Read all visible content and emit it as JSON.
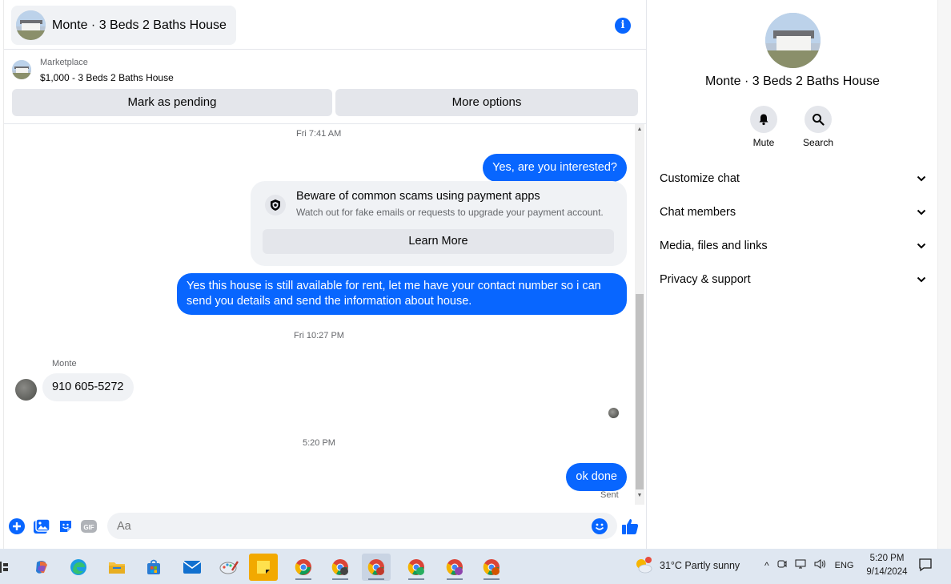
{
  "chat_header": {
    "title": "Monte · 3 Beds 2 Baths House"
  },
  "listing": {
    "source": "Marketplace",
    "price_title": "$1,000 - 3 Beds 2 Baths House",
    "mark_pending_label": "Mark as pending",
    "more_options_label": "More options"
  },
  "messages": {
    "ts1": "Fri 7:41 AM",
    "msg1": "Yes, are you interested?",
    "scam_title": "Beware of common scams using payment apps",
    "scam_desc": "Watch out for fake emails or requests to upgrade your payment account.",
    "learn_more": "Learn More",
    "msg2": "Yes this house is still available for rent, let me have your contact number so i can send you details and send the information about house.",
    "ts2": "Fri 10:27 PM",
    "sender_name": "Monte",
    "msg3": "910 605-5272",
    "ts3": "5:20 PM",
    "msg4": "ok done",
    "status": "Sent"
  },
  "composer": {
    "placeholder": "Aa",
    "gif_label": "GIF"
  },
  "details": {
    "title": "Monte · 3 Beds 2 Baths House",
    "mute_label": "Mute",
    "search_label": "Search",
    "sections": [
      "Customize chat",
      "Chat members",
      "Media, files and links",
      "Privacy & support"
    ]
  },
  "taskbar": {
    "weather": "31°C  Partly sunny",
    "language": "ENG",
    "time": "5:20 PM",
    "date": "9/14/2024"
  },
  "colors": {
    "accent": "#0866ff",
    "bubble_in": "#f0f2f5",
    "button_gray": "#e4e6eb"
  }
}
